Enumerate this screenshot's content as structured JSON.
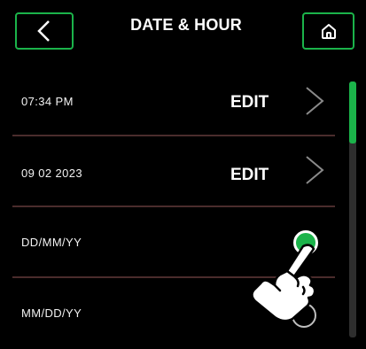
{
  "header": {
    "title": "DATE & HOUR",
    "back_icon": "chevron-left-icon",
    "home_icon": "home-icon"
  },
  "rows": [
    {
      "label": "07:34 PM",
      "action": "EDIT"
    },
    {
      "label": "09 02 2023",
      "action": "EDIT"
    },
    {
      "label": "DD/MM/YY",
      "selected": true
    },
    {
      "label": "MM/DD/YY",
      "selected": false
    }
  ],
  "colors": {
    "accent": "#1bb34a",
    "background": "#000000",
    "divider": "#4a2c2c",
    "scroll_track": "#2e2e2e"
  }
}
